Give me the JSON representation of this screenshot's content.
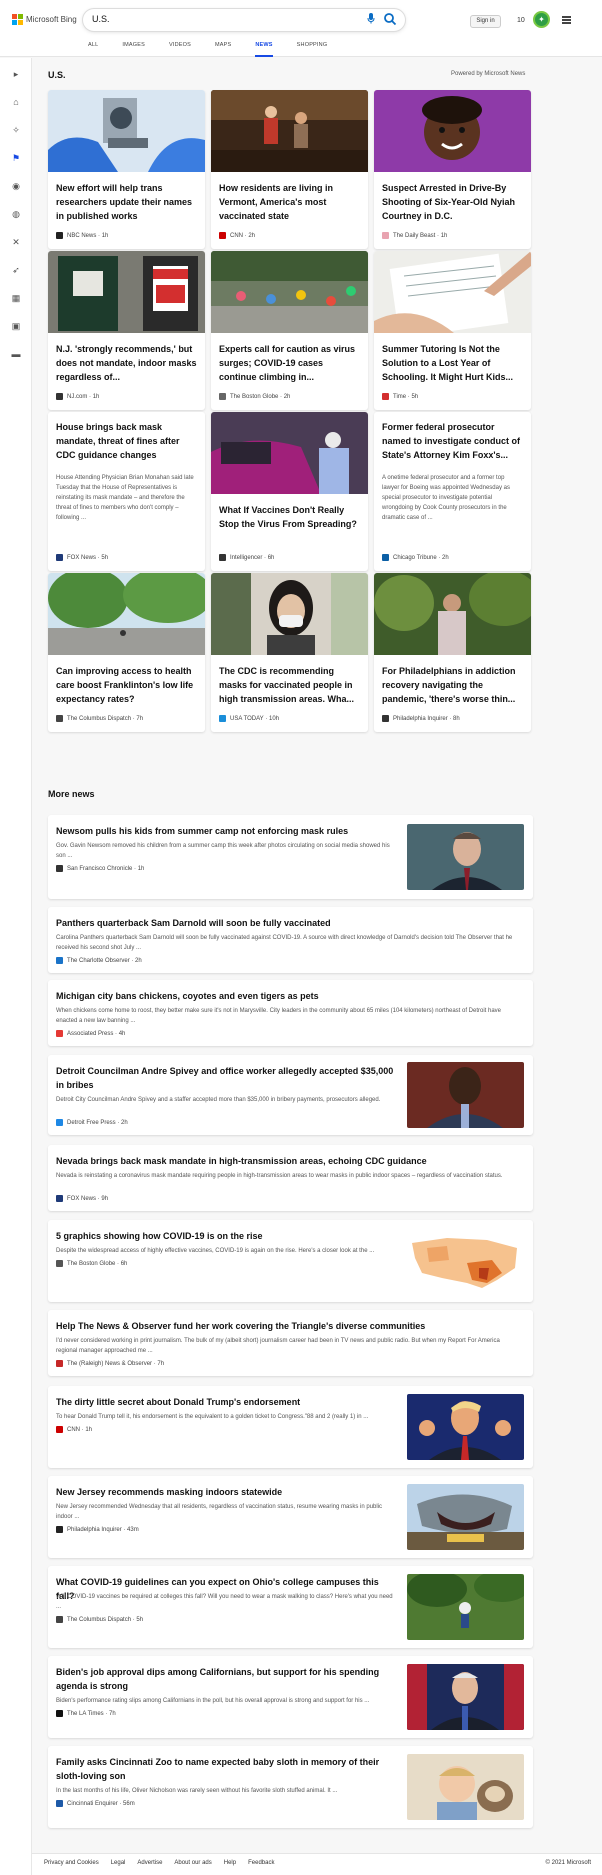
{
  "header": {
    "brand": "Microsoft Bing",
    "search_value": "U.S.",
    "signin_label": "Sign in",
    "points": "10",
    "tabs": [
      "ALL",
      "IMAGES",
      "VIDEOS",
      "MAPS",
      "NEWS",
      "SHOPPING"
    ],
    "active_tab": "NEWS"
  },
  "section": {
    "title": "U.S.",
    "powered": "Powered by Microsoft News"
  },
  "cards": [
    {
      "title": "New effort will help trans researchers update their names in published works",
      "source": "NBC News",
      "time": "1h"
    },
    {
      "title": "How residents are living in Vermont, America's most vaccinated state",
      "source": "CNN",
      "time": "2h"
    },
    {
      "title": "Suspect Arrested in Drive-By Shooting of Six-Year-Old Nyiah Courtney in D.C.",
      "source": "The Daily Beast",
      "time": "1h"
    },
    {
      "title": "N.J. 'strongly recommends,' but does not mandate, indoor masks regardless of...",
      "source": "NJ.com",
      "time": "1h"
    },
    {
      "title": "Experts call for caution as virus surges; COVID-19 cases continue climbing in...",
      "source": "The Boston Globe",
      "time": "2h"
    },
    {
      "title": "Summer Tutoring Is Not the Solution to a Lost Year of Schooling. It Might Hurt Kids...",
      "source": "Time",
      "time": "5h"
    },
    {
      "title": "House brings back mask mandate, threat of fines after CDC guidance changes",
      "snippet": "House Attending Physician Brian Monahan said late Tuesday that the House of Representatives is reinstating its mask mandate – and therefore the threat of fines to members who don't comply – following ...",
      "source": "FOX News",
      "time": "5h"
    },
    {
      "title": "What If Vaccines Don't Really Stop the Virus From Spreading?",
      "source": "Intelligencer",
      "time": "6h"
    },
    {
      "title": "Former federal prosecutor named to investigate conduct of State's Attorney Kim Foxx's...",
      "snippet": "A onetime federal prosecutor and a former top lawyer for Boeing was appointed Wednesday as special prosecutor to investigate potential wrongdoing by Cook County prosecutors in the dramatic case of ...",
      "source": "Chicago Tribune",
      "time": "2h"
    },
    {
      "title": "Can improving access to health care boost Franklinton's low life expectancy rates?",
      "source": "The Columbus Dispatch",
      "time": "7h"
    },
    {
      "title": "The CDC is recommending masks for vaccinated people in high transmission areas. Wha...",
      "source": "USA TODAY",
      "time": "10h"
    },
    {
      "title": "For Philadelphians in addiction recovery navigating the pandemic, 'there's worse thin...",
      "source": "Philadelphia Inquirer",
      "time": "8h"
    }
  ],
  "more_news_title": "More news",
  "more_news": [
    {
      "title": "Newsom pulls his kids from summer camp not enforcing mask rules",
      "snippet": "Gov. Gavin Newsom removed his children from a summer camp this week after photos circulating on social media showed his son ...",
      "source": "San Francisco Chronicle",
      "time": "1h"
    },
    {
      "title": "Panthers quarterback Sam Darnold will soon be fully vaccinated",
      "snippet": "Carolina Panthers quarterback Sam Darnold will soon be fully vaccinated against COVID-19. A source with direct knowledge of Darnold's decision told The Observer that he received his second shot July ...",
      "source": "The Charlotte Observer",
      "time": "2h"
    },
    {
      "title": "Michigan city bans chickens, coyotes and even tigers as pets",
      "snippet": "When chickens come home to roost, they better make sure it's not in Marysville. City leaders in the community about 65 miles (104 kilometers) northeast of Detroit have enacted a new law banning ...",
      "source": "Associated Press",
      "time": "4h"
    },
    {
      "title": "Detroit Councilman Andre Spivey and office worker allegedly accepted $35,000 in bribes",
      "snippet": "Detroit City Councilman Andre Spivey and a staffer accepted more than $35,000 in bribery payments, prosecutors alleged.",
      "source": "Detroit Free Press",
      "time": "2h"
    },
    {
      "title": "Nevada brings back mask mandate in high-transmission areas, echoing CDC guidance",
      "snippet": "Nevada is reinstating a coronavirus mask mandate requiring people in high-transmission areas to wear masks in public indoor spaces – regardless of vaccination status.",
      "source": "FOX News",
      "time": "9h"
    },
    {
      "title": "5 graphics showing how COVID-19 is on the rise",
      "snippet": "Despite the widespread access of highly effective vaccines, COVID-19 is again on the rise. Here's a closer look at the ...",
      "source": "The Boston Globe",
      "time": "6h"
    },
    {
      "title": "Help The News & Observer fund her work covering the Triangle's diverse communities",
      "snippet": "I'd never considered working in print journalism. The bulk of my (albeit short) journalism career had been in TV news and public radio. But when my Report For America regional manager approached me ...",
      "source": "The (Raleigh) News & Observer",
      "time": "7h"
    },
    {
      "title": "The dirty little secret about Donald Trump's endorsement",
      "snippet": "To hear Donald Trump tell it, his endorsement is the equivalent to a golden ticket to Congress.\"88 and 2 (really 1) in ...",
      "source": "CNN",
      "time": "1h"
    },
    {
      "title": "New Jersey recommends masking indoors statewide",
      "snippet": "New Jersey recommended Wednesday that all residents, regardless of vaccination status, resume wearing masks in public indoor ...",
      "source": "Philadelphia Inquirer",
      "time": "43m"
    },
    {
      "title": "What COVID-19 guidelines can you expect on Ohio's college campuses this fall?",
      "snippet": "Will COVID-19 vaccines be required at colleges this fall? Will you need to wear a mask walking to class? Here's what you need ...",
      "source": "The Columbus Dispatch",
      "time": "5h"
    },
    {
      "title": "Biden's job approval dips among Californians, but support for his spending agenda is strong",
      "snippet": "Biden's performance rating slips among Californians in the poll, but his overall approval is strong and support for his ...",
      "source": "The LA Times",
      "time": "7h"
    },
    {
      "title": "Family asks Cincinnati Zoo to name expected baby sloth in memory of their sloth-loving son",
      "snippet": "In the last months of his life, Oliver Nicholson was rarely seen without his favorite sloth stuffed animal. It ...",
      "source": "Cincinnati Enquirer",
      "time": "56m"
    }
  ],
  "footer": {
    "links": [
      "Privacy and Cookies",
      "Legal",
      "Advertise",
      "About our ads",
      "Help",
      "Feedback"
    ],
    "copyright": "© 2021 Microsoft"
  },
  "colors": {
    "accent": "#174ae4",
    "reward": "#2f9e44"
  }
}
